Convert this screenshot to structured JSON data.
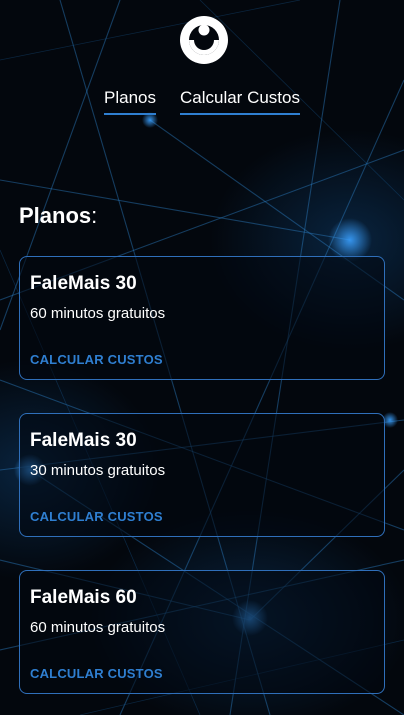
{
  "nav": {
    "items": [
      {
        "label": "Planos"
      },
      {
        "label": "Calcular Custos"
      }
    ]
  },
  "section": {
    "title": "Planos",
    "suffix": ":"
  },
  "plans": [
    {
      "name": "FaleMais 30",
      "minutes": "60 minutos gratuitos",
      "action": "CALCULAR CUSTOS"
    },
    {
      "name": "FaleMais 30",
      "minutes": "30 minutos gratuitos",
      "action": "CALCULAR CUSTOS"
    },
    {
      "name": "FaleMais 60",
      "minutes": "60 minutos gratuitos",
      "action": "CALCULAR CUSTOS"
    }
  ],
  "colors": {
    "accent": "#2f7fd1",
    "background": "#03070d",
    "card_border": "#2f6fba"
  },
  "icons": {
    "logo": "moon-smile-logo-icon"
  }
}
